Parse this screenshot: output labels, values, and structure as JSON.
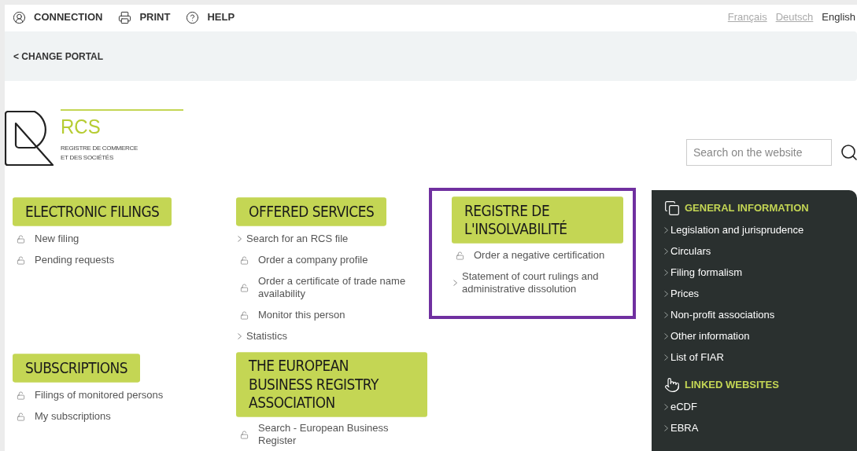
{
  "top_bar": {
    "links": [
      {
        "kind": "user",
        "label": "CONNECTION"
      },
      {
        "kind": "print",
        "label": "PRINT"
      },
      {
        "kind": "help",
        "label": "HELP"
      }
    ],
    "languages": [
      {
        "label": "Français",
        "selected": false
      },
      {
        "label": "Deutsch",
        "selected": false
      },
      {
        "label": "English",
        "selected": true
      }
    ]
  },
  "portal_bar": {
    "link": "< CHANGE PORTAL"
  },
  "logo": {
    "name": "RCS",
    "subtitle_lines": [
      "REGISTRE DE COMMERCE",
      "ET DES SOCIÉTÉS"
    ]
  },
  "search": {
    "placeholder": "Search on the website"
  },
  "sections": [
    {
      "title": "ELECTRONIC FILINGS",
      "highlighted": false,
      "items": [
        {
          "kind": "lock",
          "label": "New filing"
        },
        {
          "kind": "lock",
          "label": "Pending requests"
        }
      ]
    },
    {
      "title": "OFFERED SERVICES",
      "highlighted": false,
      "items": [
        {
          "kind": "link",
          "label": "Search for an RCS file"
        },
        {
          "kind": "lock",
          "label": "Order a company profile"
        },
        {
          "kind": "lock",
          "label": "Order a certificate of trade name availability"
        },
        {
          "kind": "lock",
          "label": "Monitor this person"
        },
        {
          "kind": "link",
          "label": "Statistics"
        }
      ]
    },
    {
      "title": "REGISTRE DE L'INSOLVABILITÉ",
      "highlighted": true,
      "items": [
        {
          "kind": "lock",
          "label": "Order a negative certification"
        },
        {
          "kind": "link",
          "label": "Statement of court rulings and administrative dissolution"
        }
      ]
    },
    {
      "title": "SUBSCRIPTIONS",
      "highlighted": false,
      "items": [
        {
          "kind": "lock",
          "label": "Filings of monitored persons"
        },
        {
          "kind": "lock",
          "label": "My subscriptions"
        }
      ]
    },
    {
      "title": "THE EUROPEAN BUSINESS REGISTRY ASSOCIATION",
      "highlighted": false,
      "items": [
        {
          "kind": "lock",
          "label": "Search - European Business Register"
        }
      ]
    }
  ],
  "sidebar": {
    "groups": [
      {
        "kind": "pages",
        "title": "GENERAL INFORMATION",
        "items": [
          "Legislation and jurisprudence",
          "Circulars",
          "Filing formalism",
          "Prices",
          "Non-profit associations",
          "Other information",
          "List of FIAR"
        ]
      },
      {
        "kind": "pointer",
        "title": "LINKED WEBSITES",
        "items": [
          "eCDF",
          "EBRA"
        ]
      }
    ]
  }
}
